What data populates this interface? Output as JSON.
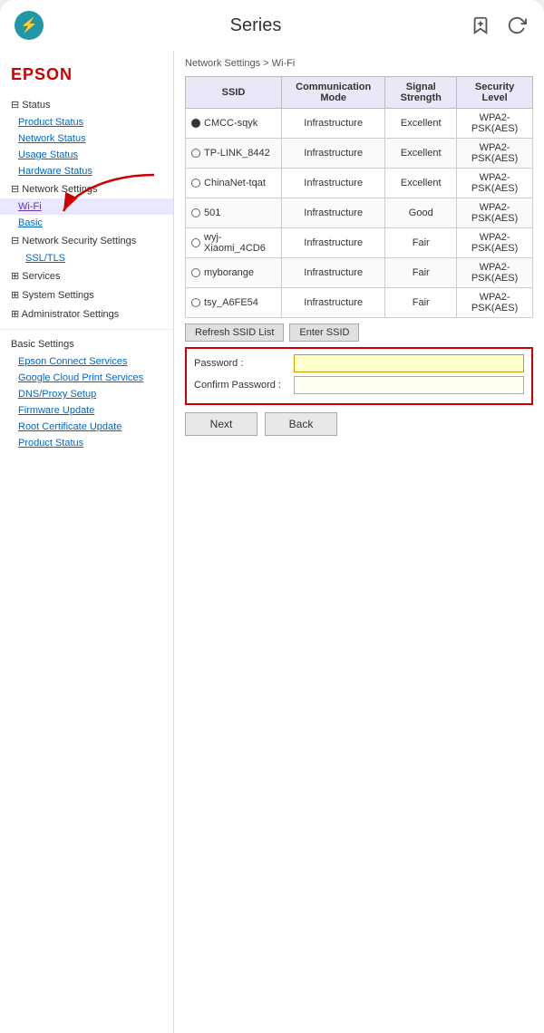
{
  "app": {
    "title": "Series",
    "top_title": "Series"
  },
  "sidebar": {
    "brand": "EPSON",
    "status_header": "Status",
    "status_links": [
      {
        "label": "Product Status",
        "active": false
      },
      {
        "label": "Network Status",
        "active": false
      },
      {
        "label": "Usage Status",
        "active": false
      },
      {
        "label": "Hardware Status",
        "active": false
      }
    ],
    "network_header": "Network Settings",
    "network_links": [
      {
        "label": "Wi-Fi",
        "active": true
      },
      {
        "label": "Basic",
        "active": false
      }
    ],
    "security_header": "Network Security Settings",
    "security_links": [
      {
        "label": "SSL/TLS",
        "active": false
      }
    ],
    "services_header": "Services",
    "system_header": "System Settings",
    "admin_header": "Administrator Settings",
    "basic_header": "Basic Settings",
    "basic_links": [
      {
        "label": "Epson Connect Services"
      },
      {
        "label": "Google Cloud Print Services"
      },
      {
        "label": "DNS/Proxy Setup"
      },
      {
        "label": "Firmware Update"
      },
      {
        "label": "Root Certificate Update"
      },
      {
        "label": "Product Status"
      }
    ]
  },
  "breadcrumb": "Network Settings > Wi-Fi",
  "table": {
    "headers": [
      "SSID",
      "Communication Mode",
      "Signal Strength",
      "Security Level"
    ],
    "rows": [
      {
        "ssid": "CMCC-sqyk",
        "selected": true,
        "mode": "Infrastructure",
        "signal": "Excellent",
        "security": "WPA2-PSK(AES)"
      },
      {
        "ssid": "TP-LINK_8442",
        "selected": false,
        "mode": "Infrastructure",
        "signal": "Excellent",
        "security": "WPA2-PSK(AES)"
      },
      {
        "ssid": "ChinaNet-tqat",
        "selected": false,
        "mode": "Infrastructure",
        "signal": "Excellent",
        "security": "WPA2-PSK(AES)"
      },
      {
        "ssid": "501",
        "selected": false,
        "mode": "Infrastructure",
        "signal": "Good",
        "security": "WPA2-PSK(AES)"
      },
      {
        "ssid": "wyj-Xiaomi_4CD6",
        "selected": false,
        "mode": "Infrastructure",
        "signal": "Fair",
        "security": "WPA2-PSK(AES)"
      },
      {
        "ssid": "myborange",
        "selected": false,
        "mode": "Infrastructure",
        "signal": "Fair",
        "security": "WPA2-PSK(AES)"
      },
      {
        "ssid": "tsy_A6FE54",
        "selected": false,
        "mode": "Infrastructure",
        "signal": "Fair",
        "security": "WPA2-PSK(AES)"
      }
    ],
    "refresh_btn": "Refresh SSID List",
    "enter_ssid_btn": "Enter SSID"
  },
  "password_section": {
    "password_label": "Password :",
    "confirm_label": "Confirm Password :"
  },
  "buttons": {
    "next": "Next",
    "back": "Back"
  }
}
